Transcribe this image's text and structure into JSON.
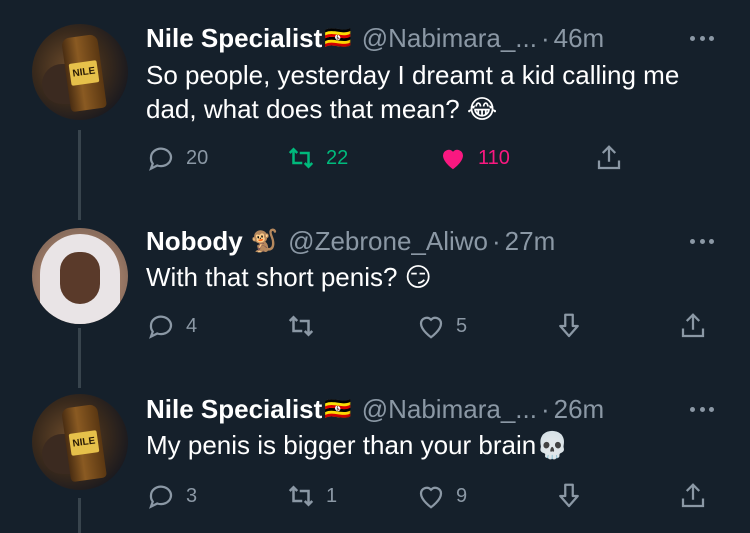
{
  "thread": {
    "tweets": [
      {
        "name": "Nile Specialist",
        "flag": "🇺🇬",
        "handle": "@Nabimara_...",
        "time": "46m",
        "text": "So people, yesterday I dreamt a kid calling me dad, what does that mean? 😂",
        "avatar_text": "NILE",
        "replies": "20",
        "retweets": "22",
        "likes": "110",
        "retweet_active": true,
        "like_active": true,
        "colors": {
          "retweet": "#00ba7c",
          "like": "#f91880"
        }
      },
      {
        "name": "Nobody",
        "emoji": "🐒",
        "handle": "@Zebrone_Aliwo",
        "time": "27m",
        "text": "With that short penis? 😏",
        "replies": "4",
        "retweets": "",
        "likes": "5"
      },
      {
        "name": "Nile Specialist",
        "flag": "🇺🇬",
        "handle": "@Nabimara_...",
        "time": "26m",
        "text": "My penis is bigger than your brain💀",
        "avatar_text": "NILE",
        "replies": "3",
        "retweets": "1",
        "likes": "9"
      }
    ]
  },
  "icons": [
    "reply-icon",
    "retweet-icon",
    "heart-icon",
    "share-icon",
    "downvote-icon",
    "more-icon"
  ],
  "theme": {
    "background": "#15202b",
    "muted": "#8b98a5",
    "thread_line": "#38444d"
  }
}
